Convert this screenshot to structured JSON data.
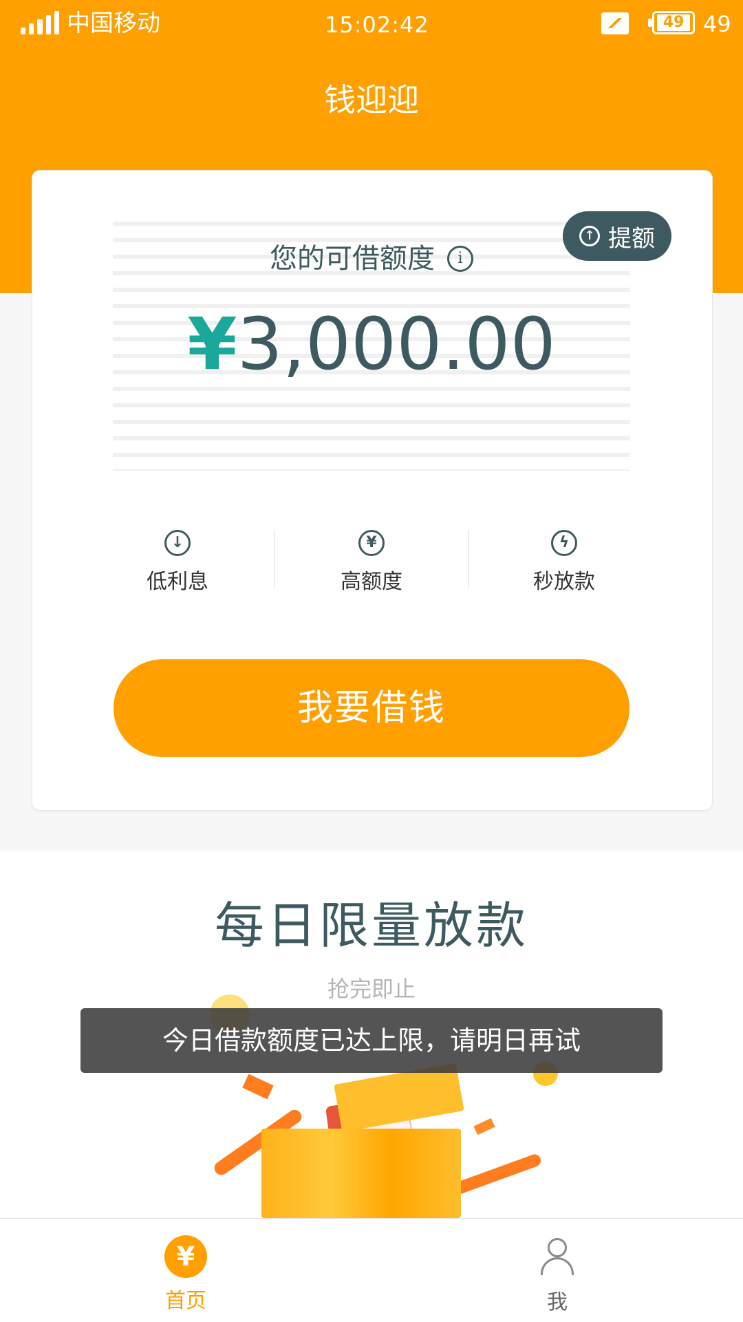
{
  "status_bar": {
    "carrier": "中国移动",
    "time": "15:02:42",
    "battery_level": "49",
    "battery_text": "49"
  },
  "header": {
    "title": "钱迎迎"
  },
  "limit_card": {
    "raise_button_label": "提额",
    "label": "您的可借额度",
    "currency_symbol": "¥",
    "amount": "3,000.00",
    "features": [
      {
        "label": "低利息",
        "icon": "arrow-down-circle-icon"
      },
      {
        "label": "高额度",
        "icon": "yen-circle-icon"
      },
      {
        "label": "秒放款",
        "icon": "lightning-circle-icon"
      }
    ],
    "borrow_button_label": "我要借钱"
  },
  "promo": {
    "title": "每日限量放款",
    "subtitle": "抢完即止"
  },
  "toast": {
    "message": "今日借款额度已达上限，请明日再试"
  },
  "bottom_nav": {
    "items": [
      {
        "label": "首页",
        "icon": "yen-circle-icon",
        "active": true
      },
      {
        "label": "我",
        "icon": "user-icon",
        "active": false
      }
    ]
  },
  "colors": {
    "brand_orange": "#ff9f00",
    "dark_teal": "#3d5a60",
    "yen_green": "#1aa89a"
  }
}
